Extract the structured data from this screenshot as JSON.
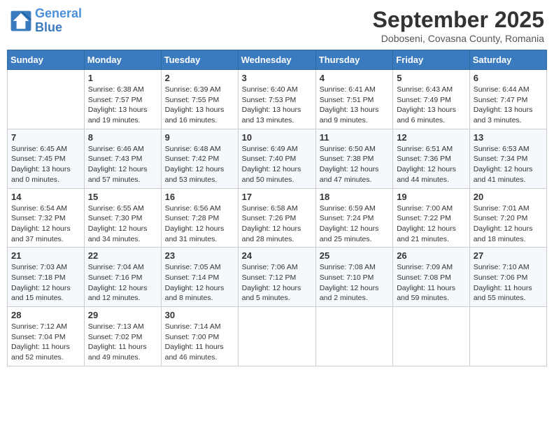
{
  "header": {
    "logo_line1": "General",
    "logo_line2": "Blue",
    "month": "September 2025",
    "location": "Doboseni, Covasna County, Romania"
  },
  "weekdays": [
    "Sunday",
    "Monday",
    "Tuesday",
    "Wednesday",
    "Thursday",
    "Friday",
    "Saturday"
  ],
  "weeks": [
    [
      {
        "day": "",
        "info": ""
      },
      {
        "day": "1",
        "info": "Sunrise: 6:38 AM\nSunset: 7:57 PM\nDaylight: 13 hours\nand 19 minutes."
      },
      {
        "day": "2",
        "info": "Sunrise: 6:39 AM\nSunset: 7:55 PM\nDaylight: 13 hours\nand 16 minutes."
      },
      {
        "day": "3",
        "info": "Sunrise: 6:40 AM\nSunset: 7:53 PM\nDaylight: 13 hours\nand 13 minutes."
      },
      {
        "day": "4",
        "info": "Sunrise: 6:41 AM\nSunset: 7:51 PM\nDaylight: 13 hours\nand 9 minutes."
      },
      {
        "day": "5",
        "info": "Sunrise: 6:43 AM\nSunset: 7:49 PM\nDaylight: 13 hours\nand 6 minutes."
      },
      {
        "day": "6",
        "info": "Sunrise: 6:44 AM\nSunset: 7:47 PM\nDaylight: 13 hours\nand 3 minutes."
      }
    ],
    [
      {
        "day": "7",
        "info": "Sunrise: 6:45 AM\nSunset: 7:45 PM\nDaylight: 13 hours\nand 0 minutes."
      },
      {
        "day": "8",
        "info": "Sunrise: 6:46 AM\nSunset: 7:43 PM\nDaylight: 12 hours\nand 57 minutes."
      },
      {
        "day": "9",
        "info": "Sunrise: 6:48 AM\nSunset: 7:42 PM\nDaylight: 12 hours\nand 53 minutes."
      },
      {
        "day": "10",
        "info": "Sunrise: 6:49 AM\nSunset: 7:40 PM\nDaylight: 12 hours\nand 50 minutes."
      },
      {
        "day": "11",
        "info": "Sunrise: 6:50 AM\nSunset: 7:38 PM\nDaylight: 12 hours\nand 47 minutes."
      },
      {
        "day": "12",
        "info": "Sunrise: 6:51 AM\nSunset: 7:36 PM\nDaylight: 12 hours\nand 44 minutes."
      },
      {
        "day": "13",
        "info": "Sunrise: 6:53 AM\nSunset: 7:34 PM\nDaylight: 12 hours\nand 41 minutes."
      }
    ],
    [
      {
        "day": "14",
        "info": "Sunrise: 6:54 AM\nSunset: 7:32 PM\nDaylight: 12 hours\nand 37 minutes."
      },
      {
        "day": "15",
        "info": "Sunrise: 6:55 AM\nSunset: 7:30 PM\nDaylight: 12 hours\nand 34 minutes."
      },
      {
        "day": "16",
        "info": "Sunrise: 6:56 AM\nSunset: 7:28 PM\nDaylight: 12 hours\nand 31 minutes."
      },
      {
        "day": "17",
        "info": "Sunrise: 6:58 AM\nSunset: 7:26 PM\nDaylight: 12 hours\nand 28 minutes."
      },
      {
        "day": "18",
        "info": "Sunrise: 6:59 AM\nSunset: 7:24 PM\nDaylight: 12 hours\nand 25 minutes."
      },
      {
        "day": "19",
        "info": "Sunrise: 7:00 AM\nSunset: 7:22 PM\nDaylight: 12 hours\nand 21 minutes."
      },
      {
        "day": "20",
        "info": "Sunrise: 7:01 AM\nSunset: 7:20 PM\nDaylight: 12 hours\nand 18 minutes."
      }
    ],
    [
      {
        "day": "21",
        "info": "Sunrise: 7:03 AM\nSunset: 7:18 PM\nDaylight: 12 hours\nand 15 minutes."
      },
      {
        "day": "22",
        "info": "Sunrise: 7:04 AM\nSunset: 7:16 PM\nDaylight: 12 hours\nand 12 minutes."
      },
      {
        "day": "23",
        "info": "Sunrise: 7:05 AM\nSunset: 7:14 PM\nDaylight: 12 hours\nand 8 minutes."
      },
      {
        "day": "24",
        "info": "Sunrise: 7:06 AM\nSunset: 7:12 PM\nDaylight: 12 hours\nand 5 minutes."
      },
      {
        "day": "25",
        "info": "Sunrise: 7:08 AM\nSunset: 7:10 PM\nDaylight: 12 hours\nand 2 minutes."
      },
      {
        "day": "26",
        "info": "Sunrise: 7:09 AM\nSunset: 7:08 PM\nDaylight: 11 hours\nand 59 minutes."
      },
      {
        "day": "27",
        "info": "Sunrise: 7:10 AM\nSunset: 7:06 PM\nDaylight: 11 hours\nand 55 minutes."
      }
    ],
    [
      {
        "day": "28",
        "info": "Sunrise: 7:12 AM\nSunset: 7:04 PM\nDaylight: 11 hours\nand 52 minutes."
      },
      {
        "day": "29",
        "info": "Sunrise: 7:13 AM\nSunset: 7:02 PM\nDaylight: 11 hours\nand 49 minutes."
      },
      {
        "day": "30",
        "info": "Sunrise: 7:14 AM\nSunset: 7:00 PM\nDaylight: 11 hours\nand 46 minutes."
      },
      {
        "day": "",
        "info": ""
      },
      {
        "day": "",
        "info": ""
      },
      {
        "day": "",
        "info": ""
      },
      {
        "day": "",
        "info": ""
      }
    ]
  ]
}
